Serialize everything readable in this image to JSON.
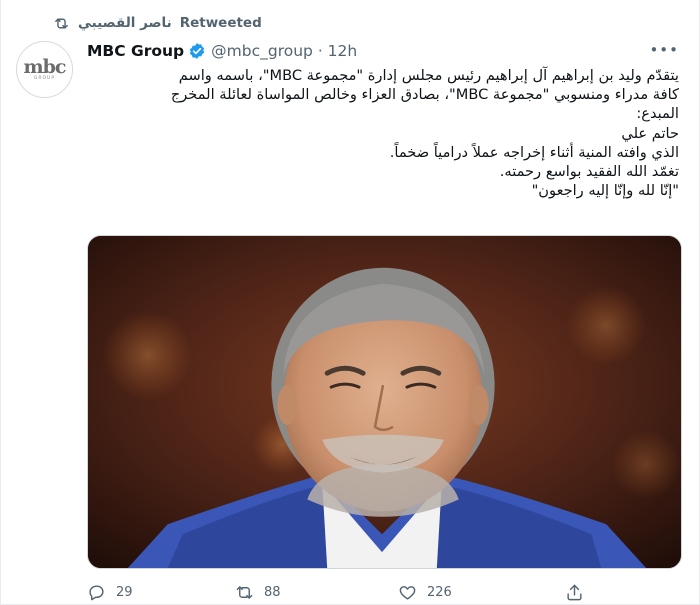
{
  "retweet": {
    "by": "ناصر القصيبي",
    "label": "Retweeted"
  },
  "author": {
    "name": "MBC Group",
    "handle": "@mbc_group",
    "time": "12h",
    "avatar_text": "mbc",
    "avatar_sub": "GROUP"
  },
  "tweet": {
    "lines": [
      "يتقدّم وليد بن إبراهيم آل إبراهيم رئيس مجلس إدارة \"مجموعة MBC\"، باسمه واسم",
      "كافة مدراء ومنسوبي \"مجموعة MBC\"، بصادق العزاء وخالص المواساة لعائلة المخرج",
      "المبدع:",
      "حاتم علي",
      "الذي وافته المنية أثناء إخراجه عملاً درامياً ضخماً.",
      "تغمّد الله الفقيد بواسع رحمته.",
      "\"إنّا لله وإنّا إليه راجعون\""
    ]
  },
  "actions": {
    "replies": "29",
    "retweets": "88",
    "likes": "226"
  },
  "icons": {
    "retweet": "retweet-icon",
    "verified": "verified-badge-icon",
    "more": "more-options-icon",
    "reply": "reply-icon",
    "like": "heart-icon",
    "share": "share-icon"
  },
  "colors": {
    "verified": "#1d9bf0",
    "muted": "#536471",
    "text": "#0f1419"
  }
}
